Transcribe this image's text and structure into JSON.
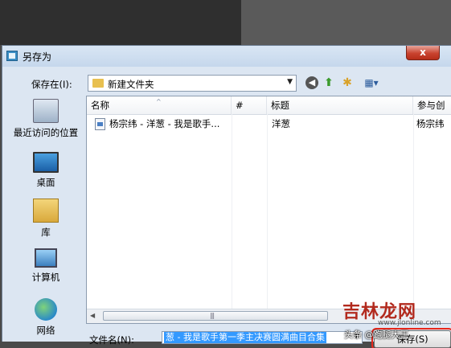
{
  "dialog": {
    "title": "另存为",
    "close_glyph": "x"
  },
  "toolbar": {
    "save_in_label": "保存在(I):",
    "current_folder": "新建文件夹",
    "icons": [
      "back-icon",
      "up-folder-icon",
      "new-folder-icon",
      "views-menu-icon"
    ]
  },
  "places": [
    {
      "label": "最近访问的位置",
      "icon": "recent-places-icon"
    },
    {
      "label": "桌面",
      "icon": "desktop-icon"
    },
    {
      "label": "库",
      "icon": "libraries-icon"
    },
    {
      "label": "计算机",
      "icon": "computer-icon"
    },
    {
      "label": "网络",
      "icon": "network-icon"
    }
  ],
  "file_list": {
    "columns": [
      "名称",
      "#",
      "标题",
      "参与创"
    ],
    "rows": [
      {
        "name": "杨宗纬 - 洋葱 - 我是歌手...",
        "track": "",
        "title": "洋葱",
        "artist": "杨宗纬"
      }
    ],
    "scroll_grip": "|||"
  },
  "footer": {
    "filename_label": "文件名(N):",
    "filename_value": "葱 - 我是歌手第一季主决赛圆满曲目合集",
    "save_button": "保存(S)"
  },
  "watermark": {
    "brand": "吉林龙网",
    "domain": "www.jlonline.com",
    "sub": "头条 @跑腿大王"
  }
}
